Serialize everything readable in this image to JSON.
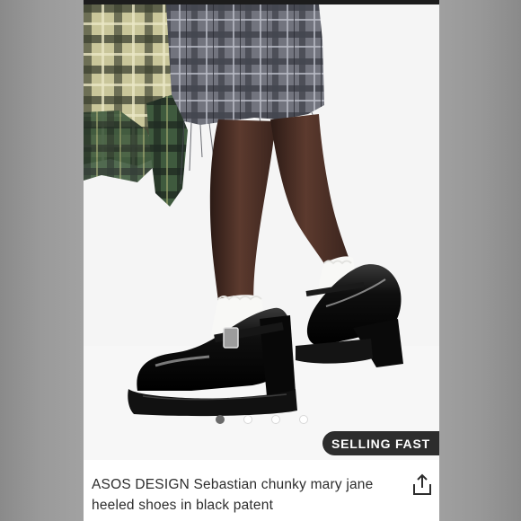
{
  "product": {
    "title": "ASOS DESIGN Sebastian chunky mary jane heeled shoes in black patent",
    "badge": "SELLING FAST"
  },
  "gallery": {
    "image_count": 4,
    "active_index": 0
  },
  "icons": {
    "share": "share-icon"
  },
  "colors": {
    "badge_bg": "#2d2d2d",
    "dot_active": "#6a6a6a"
  }
}
